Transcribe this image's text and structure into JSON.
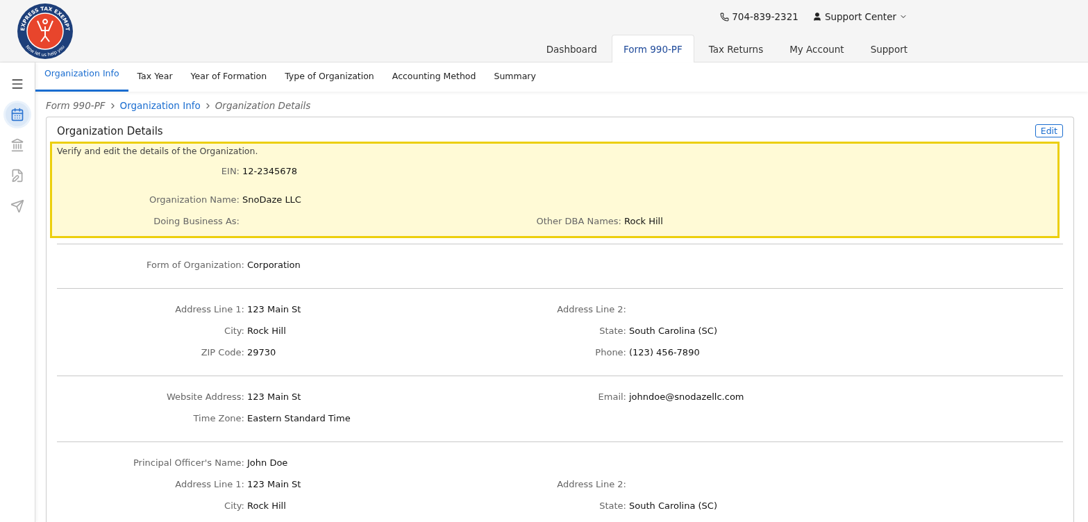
{
  "logo": {
    "name": "EXPRESS TAX EXEMPT",
    "tagline": "Now let us help you"
  },
  "contact": {
    "phone": "704-839-2321",
    "support": "Support Center"
  },
  "main_tabs": [
    {
      "label": "Dashboard",
      "selected": false
    },
    {
      "label": "Form 990-PF",
      "selected": true
    },
    {
      "label": "Tax Returns",
      "selected": false
    },
    {
      "label": "My Account",
      "selected": false
    },
    {
      "label": "Support",
      "selected": false
    }
  ],
  "sidebar": {
    "items": [
      {
        "kind": "form",
        "selected": true
      },
      {
        "kind": "bank",
        "selected": false
      },
      {
        "kind": "edit",
        "selected": false
      },
      {
        "kind": "send",
        "selected": false
      }
    ]
  },
  "sub_tabs": [
    {
      "label": "Organization Info",
      "selected": true
    },
    {
      "label": "Tax Year",
      "selected": false
    },
    {
      "label": "Year of Formation",
      "selected": false
    },
    {
      "label": "Type of Organization",
      "selected": false
    },
    {
      "label": "Accounting Method",
      "selected": false
    },
    {
      "label": "Summary",
      "selected": false
    }
  ],
  "breadcrumb": [
    {
      "label": "Form 990-PF",
      "kind": "plain"
    },
    {
      "label": "Organization Info",
      "kind": "link"
    },
    {
      "label": "Organization Details",
      "kind": "current"
    }
  ],
  "card": {
    "title": "Organization Details",
    "edit_button": "Edit",
    "sections": [
      {
        "highlighted": true,
        "note": "Verify and edit the details of the Organization.",
        "rows": [
          [
            {
              "label": "EIN:",
              "value": "12-2345678"
            }
          ],
          [
            {
              "label": "Organization Name:",
              "value": "SnoDaze LLC"
            }
          ],
          [
            {
              "label": "Doing Business As:"
            },
            {
              "label": "Other DBA Names:",
              "value": "Rock Hill"
            }
          ]
        ]
      },
      {
        "highlighted": false,
        "rows": [
          [
            {
              "label": "Form of Organization:",
              "value": "Corporation"
            }
          ]
        ]
      },
      {
        "highlighted": false,
        "rows": [
          [
            {
              "label": "Address Line 1:",
              "value": "123 Main St"
            },
            {
              "label": "Address Line 2:"
            }
          ],
          [
            {
              "label": "City:",
              "value": "Rock Hill"
            },
            {
              "label": "State:",
              "value": "South Carolina (SC)"
            }
          ],
          [
            {
              "label": "ZIP Code:",
              "value": "29730"
            },
            {
              "label": "Phone:",
              "value": "(123) 456-7890"
            }
          ]
        ]
      },
      {
        "highlighted": false,
        "rows": [
          [
            {
              "label": "Website Address:",
              "value": "123 Main St"
            },
            {
              "label": "Email:",
              "value": "johndoe@snodazellc.com"
            }
          ],
          [
            {
              "label": "Time Zone:",
              "value": "Eastern Standard Time"
            }
          ]
        ]
      },
      {
        "highlighted": false,
        "rows": [
          [
            {
              "label": "Principal Officer's Name:",
              "value": "John Doe"
            }
          ],
          [
            {
              "label": "Address Line 1:",
              "value": "123 Main St"
            },
            {
              "label": "Address Line 2:"
            }
          ],
          [
            {
              "label": "City:",
              "value": "Rock Hill"
            },
            {
              "label": "State:",
              "value": "South Carolina (SC)"
            }
          ]
        ]
      }
    ]
  }
}
